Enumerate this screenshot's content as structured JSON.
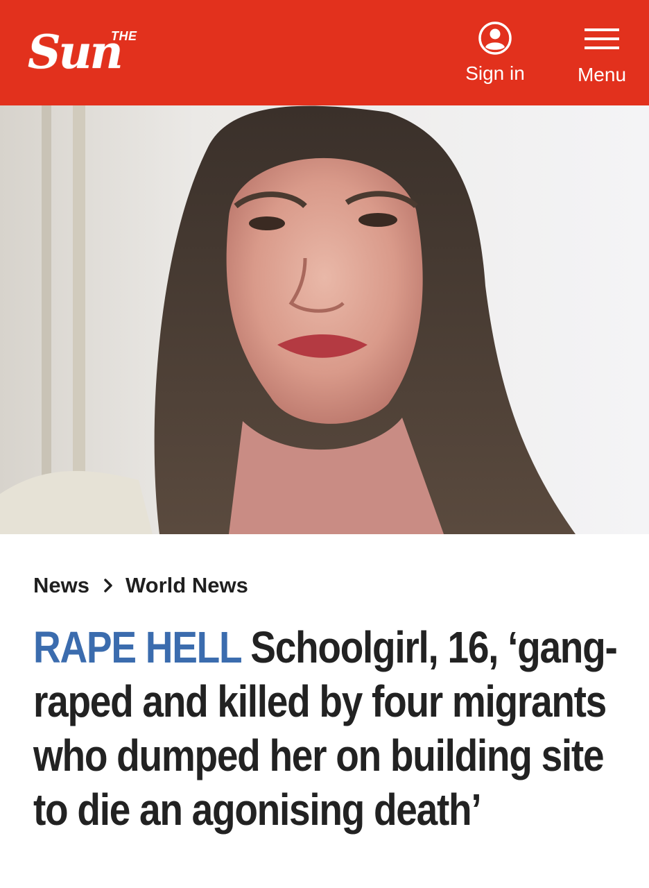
{
  "header": {
    "logo_small": "THE",
    "logo_main": "Sun",
    "signin_label": "Sign in",
    "menu_label": "Menu",
    "background_color": "#e2311d"
  },
  "hero": {
    "icon": "hero-photo"
  },
  "breadcrumb": {
    "items": [
      "News",
      "World News"
    ]
  },
  "article": {
    "kicker": "RAPE HELL",
    "headline": "Schoolgirl, 16, ‘gang-raped and killed by four migrants who dumped her on building site to die an agonising death’",
    "kicker_color": "#3b6cae"
  }
}
